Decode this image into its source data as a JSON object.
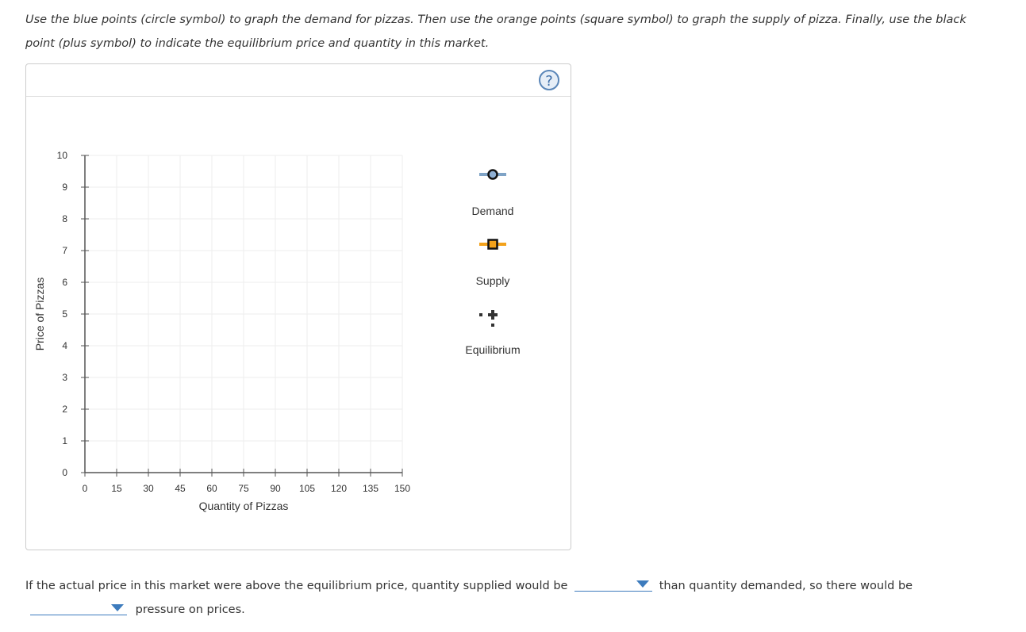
{
  "instructions": "Use the blue points (circle symbol) to graph the demand for pizzas. Then use the orange points (square symbol) to graph the supply of pizza. Finally, use the black point (plus symbol) to indicate the equilibrium price and quantity in this market.",
  "help_label": "?",
  "chart_data": {
    "type": "scatter",
    "xlabel": "Quantity of Pizzas",
    "ylabel": "Price of Pizzas",
    "xlim": [
      0,
      150
    ],
    "ylim": [
      0,
      10
    ],
    "xticks": [
      "0",
      "15",
      "30",
      "45",
      "60",
      "75",
      "90",
      "105",
      "120",
      "135",
      "150"
    ],
    "yticks": [
      "0",
      "1",
      "2",
      "3",
      "4",
      "5",
      "6",
      "7",
      "8",
      "9",
      "10"
    ],
    "grid": true,
    "legend": [
      {
        "name": "Demand",
        "symbol": "circle",
        "color": "#8fb0d4",
        "line_color": "#7fa3c6"
      },
      {
        "name": "Supply",
        "symbol": "square",
        "color": "#f3a21b",
        "line_color": "#f3a21b"
      },
      {
        "name": "Equilibrium",
        "symbol": "plus",
        "color": "#333333"
      }
    ],
    "legend_placement": "right",
    "series": []
  },
  "question": {
    "part1": "If the actual price in this market were above the equilibrium price, quantity supplied would be",
    "part2": "than quantity demanded, so there would be",
    "part3": "pressure on prices.",
    "dropdown1_value": "",
    "dropdown2_value": ""
  }
}
